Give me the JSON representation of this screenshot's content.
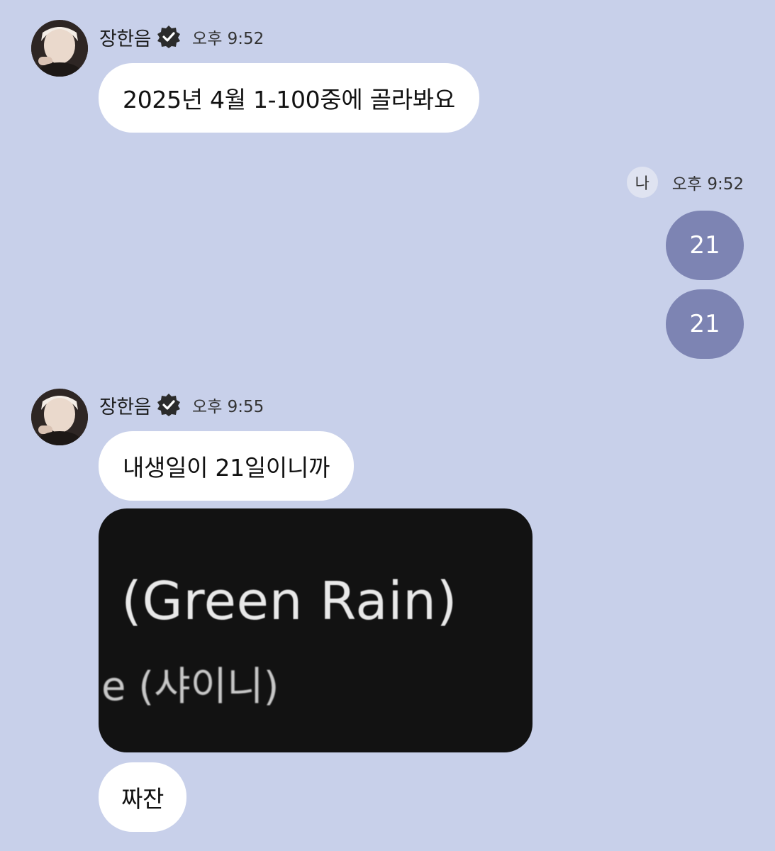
{
  "chat": {
    "contact_name": "장한음",
    "contact_verified_icon": "verified-badge-icon",
    "me_label": "나",
    "messages_group1": {
      "time": "오후 9:52",
      "text1": "2025년 4월 1-100중에 골라봐요"
    },
    "my_group": {
      "time": "오후 9:52",
      "text1": "21",
      "text2": "21"
    },
    "messages_group2": {
      "time": "오후 9:55",
      "text1": "내생일이 21일이니까",
      "image_line1": "(Green Rain)",
      "image_line2": "e (샤이니)",
      "text2": "짜잔"
    }
  },
  "colors": {
    "background": "#c8d0ea",
    "incoming_bubble": "#ffffff",
    "outgoing_bubble": "#7d84b3"
  }
}
